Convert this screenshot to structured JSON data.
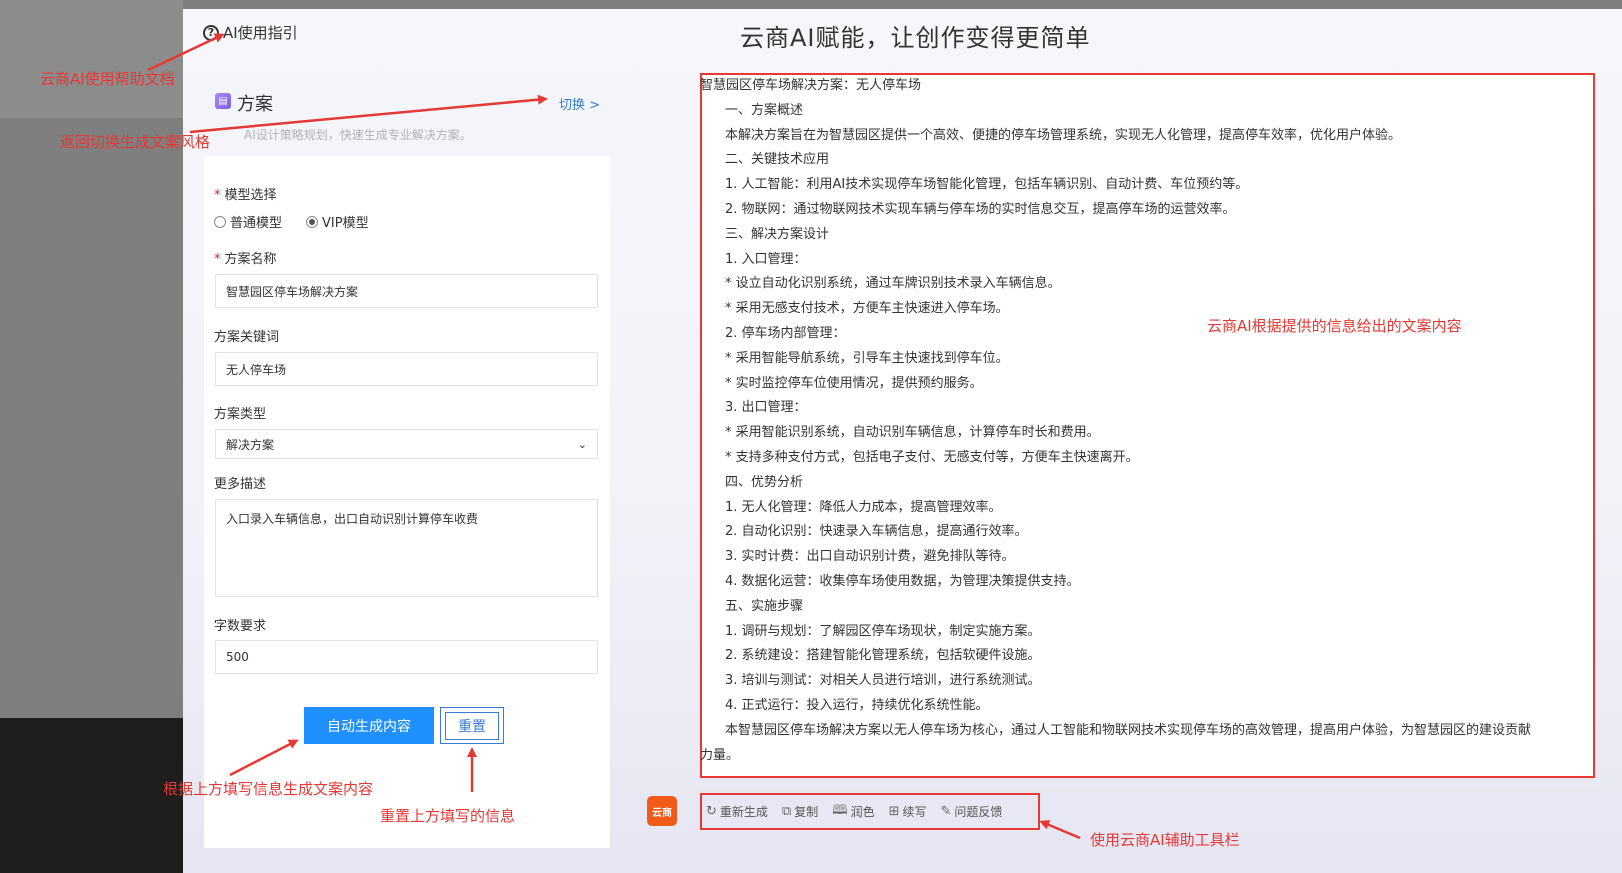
{
  "header": {
    "guide_label": "AI使用指引",
    "guide_icon": "question-circle-icon",
    "title": "云商AI赋能，让创作变得更简单"
  },
  "scheme": {
    "title": "方案",
    "switch_label": "切换 >",
    "description": "AI设计策略规划，快速生成专业解决方案。"
  },
  "form": {
    "model_label": "模型选择",
    "model_options": [
      "普通模型",
      "VIP模型"
    ],
    "model_selected": "VIP模型",
    "name_label": "方案名称",
    "name_value": "智慧园区停车场解决方案",
    "keyword_label": "方案关键词",
    "keyword_value": "无人停车场",
    "type_label": "方案类型",
    "type_value": "解决方案",
    "desc_label": "更多描述",
    "desc_value": "入口录入车辆信息，出口自动识别计算停车收费",
    "words_label": "字数要求",
    "words_value": "500",
    "generate_label": "自动生成内容",
    "reset_label": "重置"
  },
  "result": {
    "lines": [
      "智慧园区停车场解决方案：无人停车场",
      "一、方案概述",
      "本解决方案旨在为智慧园区提供一个高效、便捷的停车场管理系统，实现无人化管理，提高停车效率，优化用户体验。",
      "二、关键技术应用",
      "1. 人工智能：利用AI技术实现停车场智能化管理，包括车辆识别、自动计费、车位预约等。",
      "2. 物联网：通过物联网技术实现车辆与停车场的实时信息交互，提高停车场的运营效率。",
      "三、解决方案设计",
      "1. 入口管理：",
      "* 设立自动化识别系统，通过车牌识别技术录入车辆信息。",
      "* 采用无感支付技术，方便车主快速进入停车场。",
      "2. 停车场内部管理：",
      "* 采用智能导航系统，引导车主快速找到停车位。",
      "* 实时监控停车位使用情况，提供预约服务。",
      "3. 出口管理：",
      "* 采用智能识别系统，自动识别车辆信息，计算停车时长和费用。",
      "* 支持多种支付方式，包括电子支付、无感支付等，方便车主快速离开。",
      "四、优势分析",
      "1. 无人化管理：降低人力成本，提高管理效率。",
      "2. 自动化识别：快速录入车辆信息，提高通行效率。",
      "3. 实时计费：出口自动识别计费，避免排队等待。",
      "4. 数据化运营：收集停车场使用数据，为管理决策提供支持。",
      "五、实施步骤",
      "1. 调研与规划：了解园区停车场现状，制定实施方案。",
      "2. 系统建设：搭建智能化管理系统，包括软硬件设施。",
      "3. 培训与测试：对相关人员进行培训，进行系统测试。",
      "4. 正式运行：投入运行，持续优化系统性能。",
      "本智慧园区停车场解决方案以无人停车场为核心，通过人工智能和物联网技术实现停车场的高效管理，提高用户体验，为智慧园区的建设贡献",
      "力量。"
    ]
  },
  "toolbar": {
    "logo_text": "云商",
    "items": [
      {
        "label": "重新生成",
        "icon": "refresh-icon"
      },
      {
        "label": "复制",
        "icon": "copy-icon"
      },
      {
        "label": "润色",
        "icon": "book-icon"
      },
      {
        "label": "续写",
        "icon": "continue-write-icon"
      },
      {
        "label": "问题反馈",
        "icon": "feedback-icon"
      }
    ]
  },
  "annotations": {
    "help_doc": "云商AI使用帮助文档",
    "switch_style": "返回切换生成文案风格",
    "content": "云商AI根据提供的信息给出的文案内容",
    "generate": "根据上方填写信息生成文案内容",
    "reset": "重置上方填写的信息",
    "toolbar": "使用云商AI辅助工具栏"
  },
  "colors": {
    "annotation_red": "#e53935",
    "primary_blue": "#1e90ff",
    "logo_orange": "#f25a1a"
  }
}
